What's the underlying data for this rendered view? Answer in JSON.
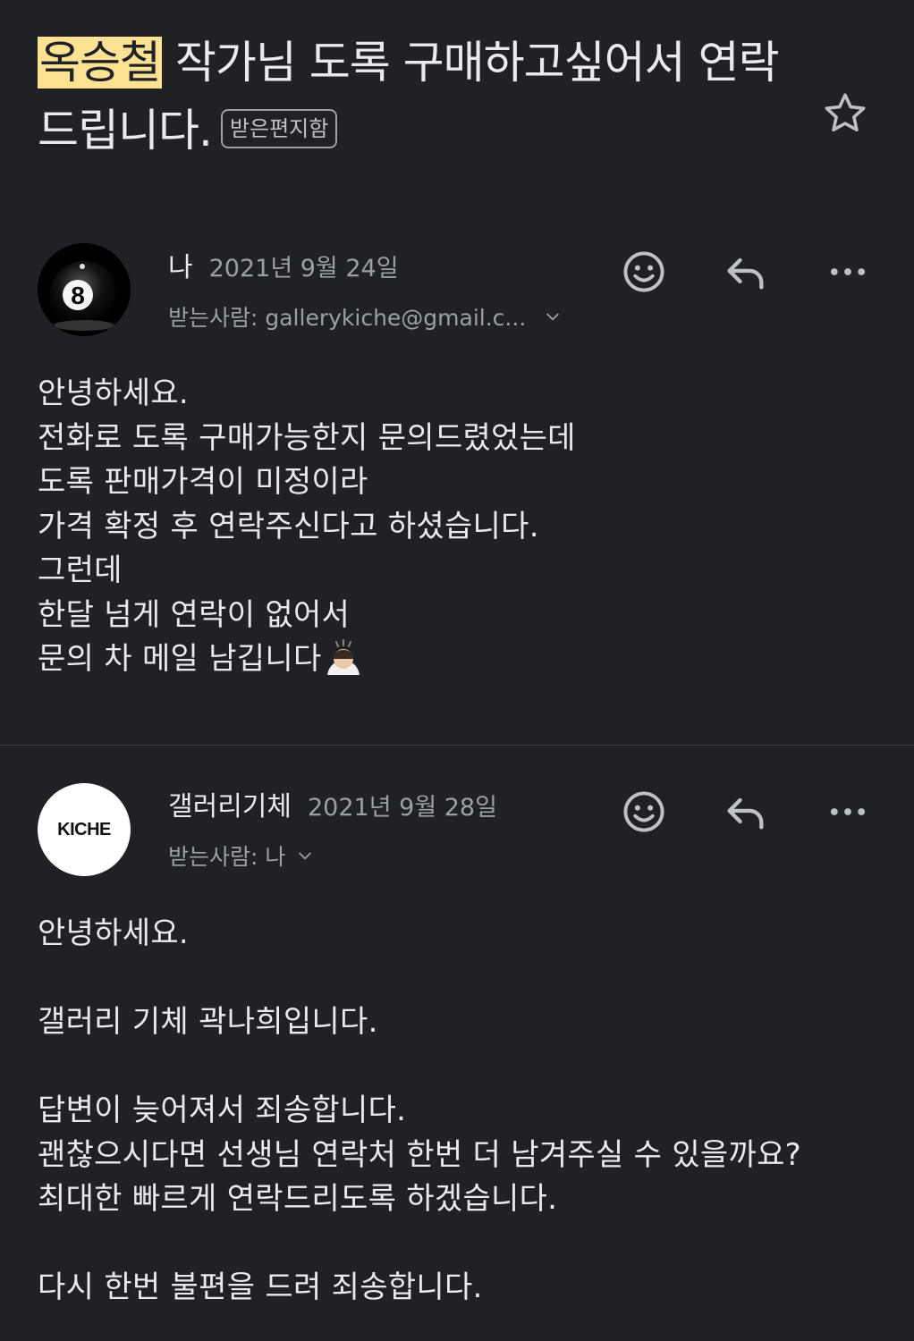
{
  "subject": {
    "highlighted": "옥승철",
    "rest": " 작가님 도록 구매하고싶어서 연락드립니다.",
    "label": "받은편지함"
  },
  "icons": {
    "star": "star-icon",
    "emoji": "emoji-reaction-icon",
    "reply": "reply-icon",
    "more": "more-icon",
    "chevron": "chevron-down-icon"
  },
  "messages": [
    {
      "sender": "나",
      "date": "2021년 9월 24일",
      "recipient": "받는사람: gallerykiche@gmail.c...",
      "avatar": "8-ball",
      "body": "안녕하세요.\n전화로 도록 구매가능한지 문의드렸었는데\n도록 판매가격이 미정이라\n가격 확정 후 연락주신다고 하셨습니다.\n그런데\n한달 넘게 연락이 없어서\n문의 차 메일 남깁니다"
    },
    {
      "sender": "갤러리기체",
      "date": "2021년 9월 28일",
      "recipient": "받는사람: 나",
      "avatar": "KICHE",
      "body": "안녕하세요.\n\n갤러리 기체 곽나희입니다.\n\n답변이 늦어져서 죄송합니다.\n괜찮으시다면 선생님 연락처 한번 더 남겨주실 수 있을까요?\n최대한 빠르게 연락드리도록 하겠습니다.\n\n다시 한번 불편을 드려 죄송합니다."
    }
  ],
  "colors": {
    "background": "#202124",
    "highlight": "#fde293",
    "text": "#e8eaed",
    "muted": "#9aa0a6"
  }
}
